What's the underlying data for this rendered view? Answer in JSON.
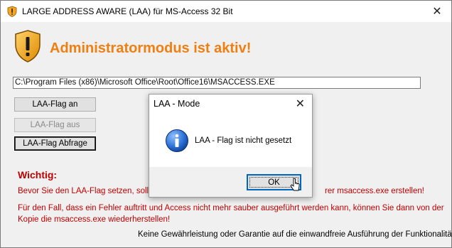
{
  "window": {
    "title": "LARGE ADDRESS AWARE (LAA) für MS-Access 32 Bit",
    "close_glyph": "✕"
  },
  "header": {
    "title": "Administratormodus ist aktiv!",
    "title_color": "#f07f12"
  },
  "path_field": {
    "value": "C:\\Program Files (x86)\\Microsoft Office\\Root\\Office16\\MSACCESS.EXE"
  },
  "buttons": {
    "flag_on": "LAA-Flag an",
    "flag_off": "LAA-Flag aus",
    "flag_query": "LAA-Flag Abfrage"
  },
  "notice": {
    "heading": "Wichtig:",
    "line1": "Bevor Sie den LAA-Flag setzen, sollte",
    "line1_end": "rer msaccess.exe erstellen!",
    "line2": "Für den Fall, dass ein Fehler auftritt und Access nicht mehr sauber ausgeführt werden kann, können Sie dann von der",
    "line3": "Kopie die msaccess.exe wiederherstellen!",
    "color": "#c00000"
  },
  "footer": {
    "text": "Keine Gewährleistung oder Garantie auf die einwandfreie Ausführung der Funktionalitäten"
  },
  "dialog": {
    "title": "LAA - Mode",
    "close_glyph": "✕",
    "icon": "info-icon",
    "message": "LAA - Flag ist nicht gesetzt",
    "ok_label": "OK"
  }
}
